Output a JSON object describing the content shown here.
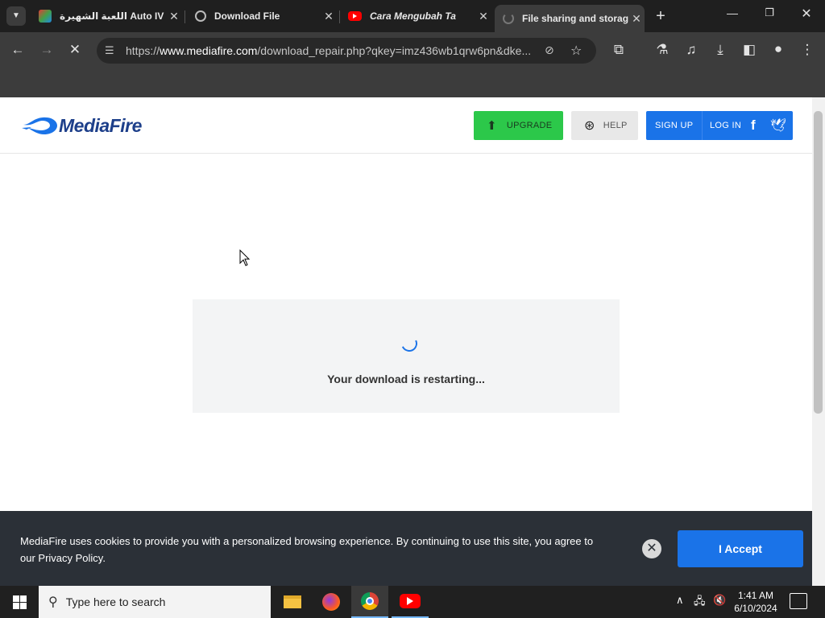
{
  "browser": {
    "tabs": [
      {
        "title": "اللعبة الشهيرة Auto IV",
        "active": false
      },
      {
        "title": "Download File",
        "active": false
      },
      {
        "title": "Cara Mengubah Ta",
        "active": false
      },
      {
        "title": "File sharing and storag",
        "active": true
      }
    ],
    "url": {
      "prefix": "https://",
      "host": "www.mediafire.com",
      "path": "/download_repair.php?qkey=imz436wb1qrw6pn&dke..."
    }
  },
  "page": {
    "logo": "MediaFire",
    "header": {
      "upgrade": "UPGRADE",
      "help": "HELP",
      "signup": "SIGN UP",
      "login": "LOG IN"
    },
    "download_message": "Your download is restarting...",
    "cookie": {
      "text": "MediaFire uses cookies to provide you with a personalized browsing experience. By continuing to use this site, you agree to our Privacy Policy.",
      "accept": "I Accept"
    }
  },
  "taskbar": {
    "search_placeholder": "Type here to search",
    "time": "1:41 AM",
    "date": "6/10/2024"
  },
  "colors": {
    "accent_blue": "#1a73e8",
    "upgrade_green": "#2cc84a",
    "banner_bg": "#2b3037"
  }
}
